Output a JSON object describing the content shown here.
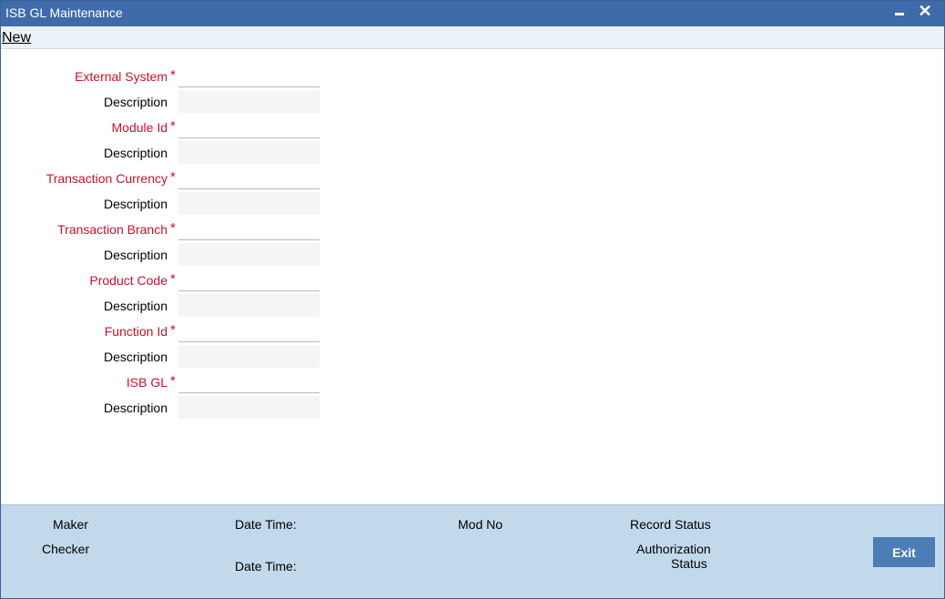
{
  "window": {
    "title": "ISB GL Maintenance",
    "minimize_icon": "minimize-icon",
    "close_symbol": "✕"
  },
  "menu": {
    "new_label": "New"
  },
  "form": {
    "rows": [
      {
        "label": "External System",
        "required": true,
        "value": ""
      },
      {
        "label": "Description",
        "required": false,
        "value": ""
      },
      {
        "label": "Module Id",
        "required": true,
        "value": ""
      },
      {
        "label": "Description",
        "required": false,
        "value": ""
      },
      {
        "label": "Transaction Currency",
        "required": true,
        "value": ""
      },
      {
        "label": "Description",
        "required": false,
        "value": ""
      },
      {
        "label": "Transaction Branch",
        "required": true,
        "value": ""
      },
      {
        "label": "Description",
        "required": false,
        "value": ""
      },
      {
        "label": "Product Code",
        "required": true,
        "value": ""
      },
      {
        "label": "Description",
        "required": false,
        "value": ""
      },
      {
        "label": "Function Id",
        "required": true,
        "value": ""
      },
      {
        "label": "Description",
        "required": false,
        "value": ""
      },
      {
        "label": "ISB GL",
        "required": true,
        "value": ""
      },
      {
        "label": "Description",
        "required": false,
        "value": ""
      }
    ],
    "required_marker": "*"
  },
  "footer": {
    "maker": "Maker",
    "checker": "Checker",
    "date_time_1": "Date Time:",
    "date_time_2": "Date Time:",
    "mod_no": "Mod No",
    "record_status": "Record Status",
    "authorization": "Authorization",
    "status": "Status",
    "exit_label": "Exit"
  },
  "colors": {
    "titlebar": "#3f6bab",
    "required_label": "#c8102e",
    "footer_bg": "#c2d9ec",
    "exit_button": "#4a7eb5"
  }
}
